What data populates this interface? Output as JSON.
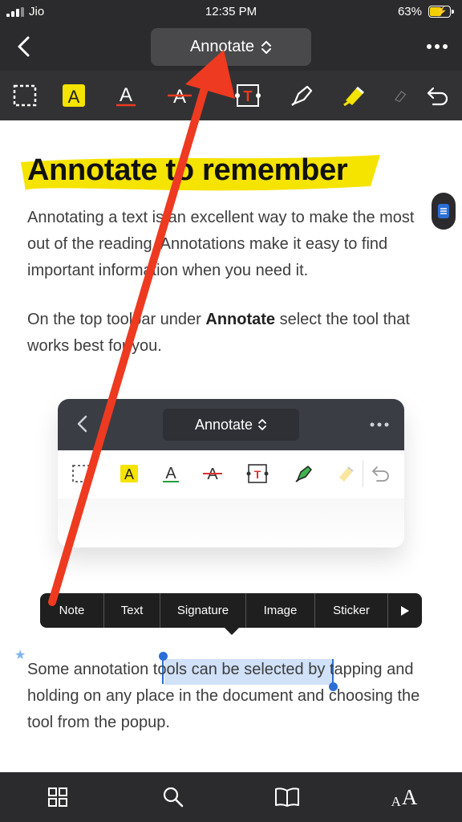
{
  "status_bar": {
    "carrier": "Jio",
    "time": "12:35 PM",
    "battery": "63%",
    "battery_level": 0.63
  },
  "nav": {
    "title": "Annotate",
    "back_icon": "chevron-left-icon",
    "more_icon": "more-horizontal-icon"
  },
  "toolbar": {
    "tools": [
      "selection-rect-icon",
      "highlight-text-icon",
      "underline-text-icon",
      "strikethrough-text-icon",
      "text-box-icon",
      "pen-icon",
      "highlighter-icon",
      "eraser-icon",
      "undo-icon"
    ]
  },
  "content": {
    "heading": "Annotate to remember",
    "p1": "Annotating a text is an excellent way to make the most out of the reading. Annotations make it easy to find important information when you need it.",
    "p2_before": "On the top toolbar under ",
    "p2_bold": "Annotate",
    "p2_after": " select the tool that works best for you.",
    "p3_before": "Some annotation ",
    "p3_selected": "tools can be selected",
    "p3_after": " by tapping and holding on any place in the document and choosing the tool from the popup."
  },
  "embedded_screenshot": {
    "title": "Annotate"
  },
  "popup_menu": {
    "items": [
      "Note",
      "Text",
      "Signature",
      "Image",
      "Sticker"
    ],
    "more_icon": "play-right-icon"
  },
  "bottom_bar": {
    "icons": [
      "grid-icon",
      "search-icon",
      "book-icon",
      "font-size-icon"
    ],
    "font_label": "AA"
  },
  "colors": {
    "bar_bg": "#2b2b2d",
    "highlight_yellow": "#f5e300",
    "arrow_red": "#ee3a20",
    "accent_blue": "#2b6fd6"
  }
}
